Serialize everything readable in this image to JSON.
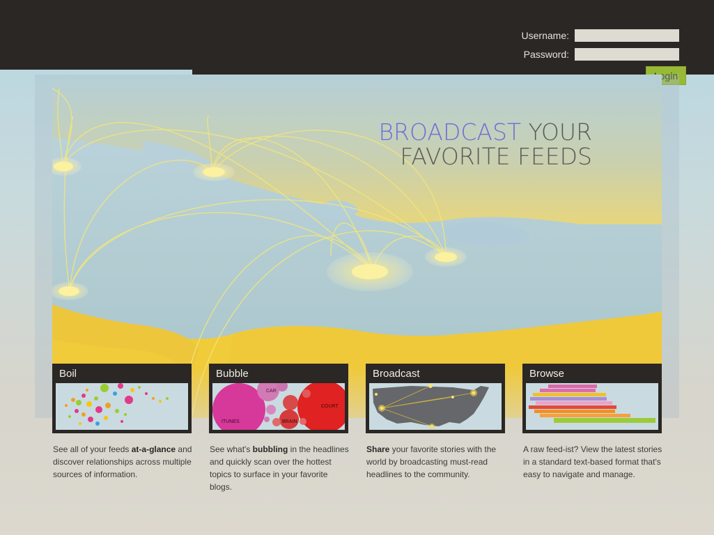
{
  "login": {
    "username_label": "Username:",
    "password_label": "Password:",
    "username_value": "",
    "password_value": "",
    "button_label": "Login"
  },
  "hero": {
    "headline_accent": "BROADCAST",
    "headline_rest": " YOUR",
    "headline_line2": "FAVORITE FEEDS"
  },
  "cards": [
    {
      "title": "Boil",
      "desc_before": "See all of your feeds ",
      "desc_bold": "at-a-glance",
      "desc_after": " and discover relationships across multiple sources of information."
    },
    {
      "title": "Bubble",
      "desc_before": "See what's ",
      "desc_bold": "bubbling",
      "desc_after": " in the headlines and quickly scan over the hottest topics to surface in your favorite blogs.",
      "bubble_labels": [
        "CAR",
        "COURT",
        "ITUNES",
        "BRAIN"
      ]
    },
    {
      "title": "Broadcast",
      "desc_before": "",
      "desc_bold": "Share",
      "desc_after": " your favorite stories with the world by broadcasting must-read headlines to the community."
    },
    {
      "title": "Browse",
      "desc_before": "A raw feed-ist? View the latest stories in a standard text-based format that's easy to navigate and manage.",
      "desc_bold": "",
      "desc_after": ""
    }
  ],
  "colors": {
    "topbar": "#2b2725",
    "accent_blue": "#6c6fd6",
    "login_green": "#98b936",
    "arc_yellow": "#f3e67a"
  }
}
